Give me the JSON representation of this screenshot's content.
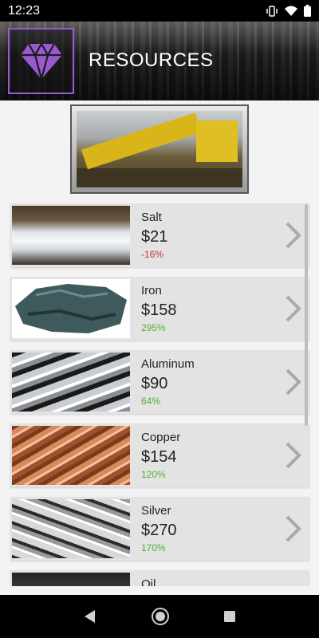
{
  "status": {
    "time": "12:23"
  },
  "header": {
    "title": "RESOURCES",
    "logo_icon": "diamond-icon",
    "accent": "#9b59d0"
  },
  "items": [
    {
      "name": "Salt",
      "price": "$21",
      "change": "-16%",
      "change_color": "#c0392b"
    },
    {
      "name": "Iron",
      "price": "$158",
      "change": "295%",
      "change_color": "#53b02a"
    },
    {
      "name": "Aluminum",
      "price": "$90",
      "change": "64%",
      "change_color": "#53b02a"
    },
    {
      "name": "Copper",
      "price": "$154",
      "change": "120%",
      "change_color": "#53b02a"
    },
    {
      "name": "Silver",
      "price": "$270",
      "change": "170%",
      "change_color": "#53b02a"
    },
    {
      "name": "Oil"
    }
  ]
}
